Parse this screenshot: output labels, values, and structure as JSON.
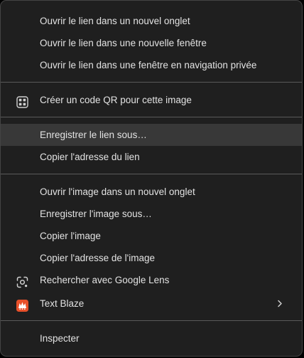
{
  "menu": {
    "items": [
      {
        "label": "Ouvrir le lien dans un nouvel onglet"
      },
      {
        "label": "Ouvrir le lien dans une nouvelle fenêtre"
      },
      {
        "label": "Ouvrir le lien dans une fenêtre en navigation privée"
      },
      {
        "label": "Créer un code QR pour cette image",
        "icon": "qr-code-icon"
      },
      {
        "label": "Enregistrer le lien sous…",
        "state": "hovered"
      },
      {
        "label": "Copier l'adresse du lien"
      },
      {
        "label": "Ouvrir l'image dans un nouvel onglet"
      },
      {
        "label": "Enregistrer l'image sous…"
      },
      {
        "label": "Copier l'image"
      },
      {
        "label": "Copier l'adresse de l'image"
      },
      {
        "label": "Rechercher avec Google Lens",
        "icon": "google-lens-icon"
      },
      {
        "label": "Text Blaze",
        "icon": "text-blaze-icon",
        "submenu_icon": "chevron-right-icon"
      },
      {
        "label": "Inspecter"
      }
    ]
  },
  "colors": {
    "background": "#1f1f1f",
    "text": "#e3e3e3",
    "hover": "#383838",
    "separator": "#5a5a5a",
    "text_blaze_brand": "#e8502a"
  }
}
